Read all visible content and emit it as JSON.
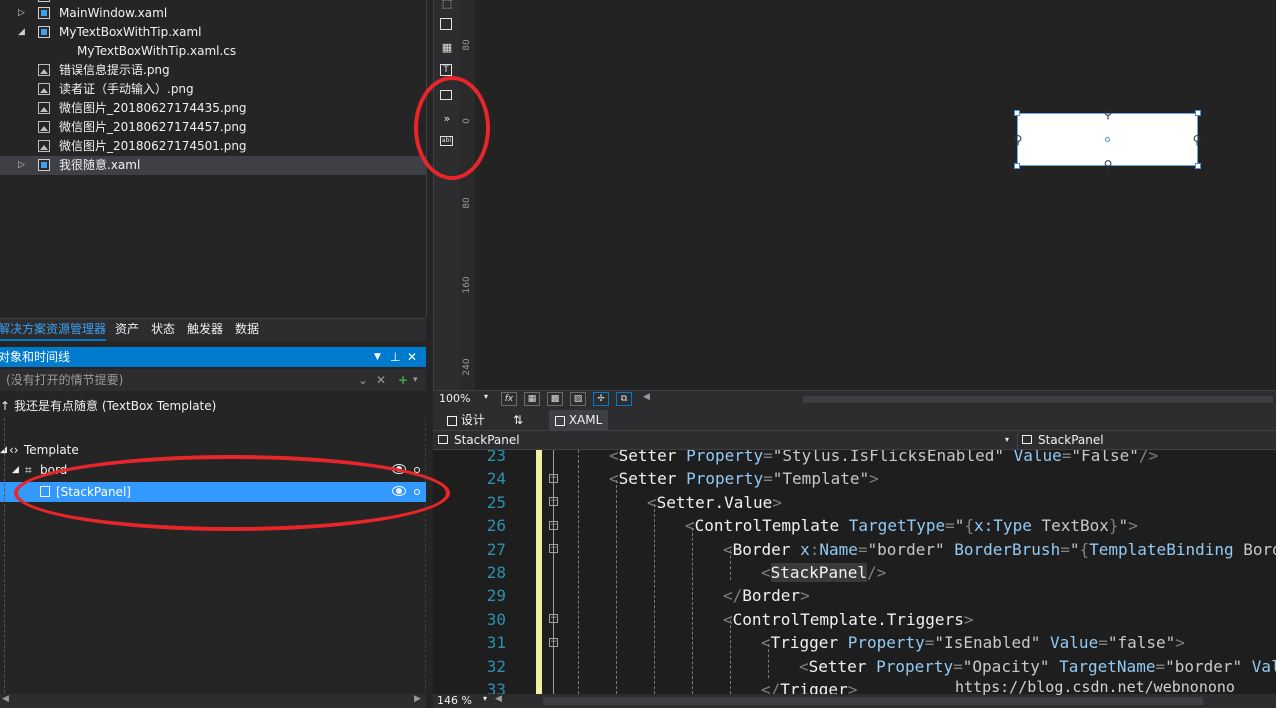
{
  "solution_explorer": {
    "items": [
      {
        "label": "MainWindow.xaml",
        "type": "xaml",
        "expander": "▷"
      },
      {
        "label": "MyTextBoxWithTip.xaml",
        "type": "xaml",
        "expander": "◢"
      },
      {
        "label": "MyTextBoxWithTip.xaml.cs",
        "type": "cs",
        "expander": ""
      },
      {
        "label": "错误信息提示语.png",
        "type": "img",
        "expander": ""
      },
      {
        "label": "读者证（手动输入）.png",
        "type": "img",
        "expander": ""
      },
      {
        "label": "微信图片_20180627174435.png",
        "type": "img",
        "expander": ""
      },
      {
        "label": "微信图片_20180627174457.png",
        "type": "img",
        "expander": ""
      },
      {
        "label": "微信图片_20180627174501.png",
        "type": "img",
        "expander": ""
      },
      {
        "label": "我很随意.xaml",
        "type": "xaml",
        "expander": "▷"
      }
    ]
  },
  "bottom_tabs": [
    "解决方案资源管理器",
    "资产",
    "状态",
    "触发器",
    "数据"
  ],
  "objects_panel": {
    "title": "对象和时间线",
    "storyboard_placeholder": "(没有打开的情节提要)",
    "root_label": "我还是有点随意 (TextBox Template)",
    "tree": [
      {
        "label": "Template",
        "expander": "◢"
      },
      {
        "label": "bord",
        "expander": "◢"
      },
      {
        "label": "[StackPanel]",
        "expander": ""
      }
    ]
  },
  "ruler_labels": [
    "80",
    "0",
    "80",
    "160",
    "240"
  ],
  "zoom": {
    "designer": "100%",
    "code": "146 %"
  },
  "view_tabs": {
    "design": "设计",
    "swap": "⇅",
    "xaml": "XAML"
  },
  "breadcrumbs": {
    "left": "StackPanel",
    "right": "StackPanel"
  },
  "code": {
    "line_numbers": [
      "23",
      "24",
      "25",
      "26",
      "27",
      "28",
      "29",
      "30",
      "31",
      "32",
      "33"
    ]
  },
  "watermark": "https://blog.csdn.net/webnonono",
  "colors": {
    "accent": "#007acc",
    "selection": "#3399ff",
    "annotation": "#e8262a"
  }
}
